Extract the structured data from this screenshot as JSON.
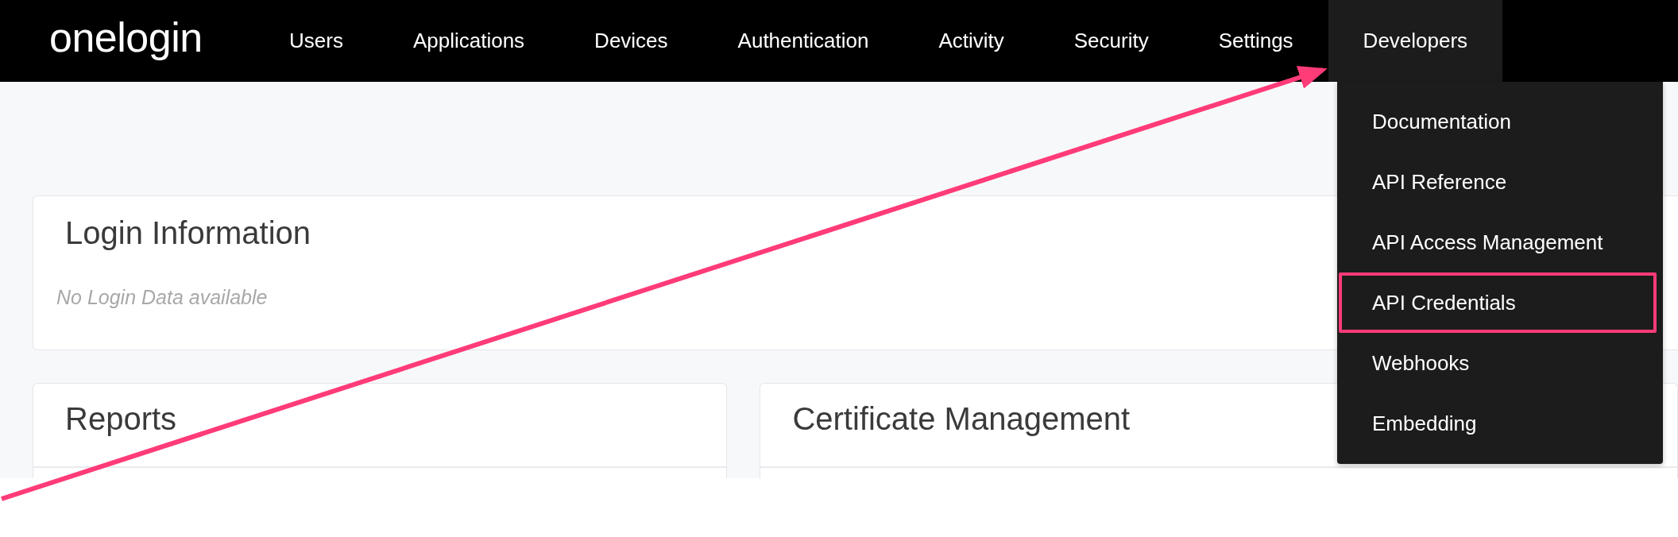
{
  "logo": "onelogin",
  "nav": [
    {
      "label": "Users",
      "selected": false
    },
    {
      "label": "Applications",
      "selected": false
    },
    {
      "label": "Devices",
      "selected": false
    },
    {
      "label": "Authentication",
      "selected": false
    },
    {
      "label": "Activity",
      "selected": false
    },
    {
      "label": "Security",
      "selected": false
    },
    {
      "label": "Settings",
      "selected": false
    },
    {
      "label": "Developers",
      "selected": true
    }
  ],
  "dropdown": [
    {
      "label": "Documentation",
      "highlighted": false
    },
    {
      "label": "API Reference",
      "highlighted": false
    },
    {
      "label": "API Access Management",
      "highlighted": false
    },
    {
      "label": "API Credentials",
      "highlighted": true
    },
    {
      "label": "Webhooks",
      "highlighted": false
    },
    {
      "label": "Embedding",
      "highlighted": false
    }
  ],
  "login_card": {
    "title": "Login Information",
    "empty_text": "No Login Data available"
  },
  "cards": [
    {
      "title": "Reports"
    },
    {
      "title": "Certificate Management"
    }
  ]
}
